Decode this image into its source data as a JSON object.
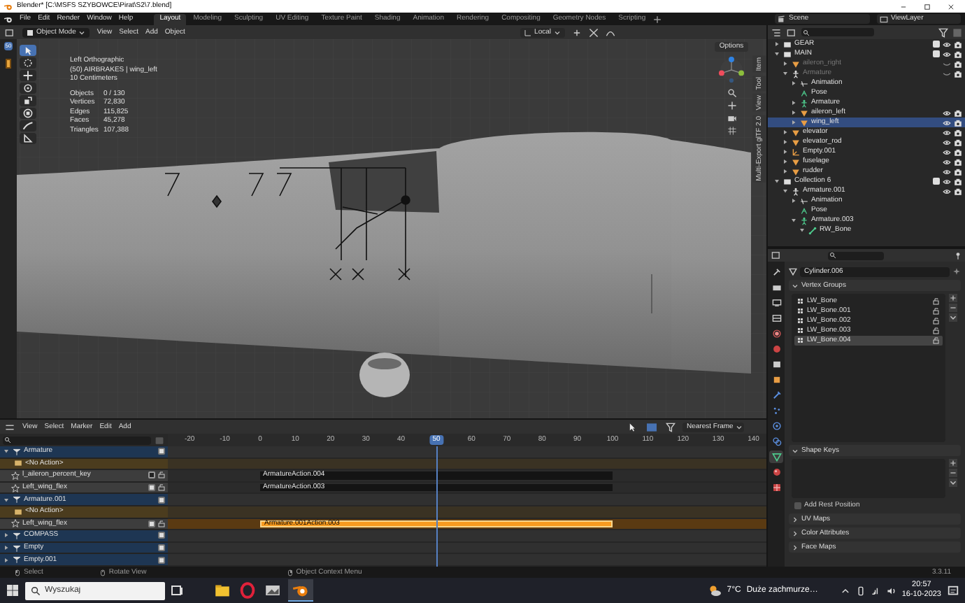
{
  "title_bar": {
    "title": "Blender* [C:\\MSFS SZYBOWCE\\Pirat\\S2\\7.blend]"
  },
  "menu": [
    "File",
    "Edit",
    "Render",
    "Window",
    "Help"
  ],
  "workspaces": [
    {
      "label": "Layout",
      "selected": true
    },
    {
      "label": "Modeling",
      "selected": false
    },
    {
      "label": "Sculpting",
      "selected": false
    },
    {
      "label": "UV Editing",
      "selected": false
    },
    {
      "label": "Texture Paint",
      "selected": false
    },
    {
      "label": "Shading",
      "selected": false
    },
    {
      "label": "Animation",
      "selected": false
    },
    {
      "label": "Rendering",
      "selected": false
    },
    {
      "label": "Compositing",
      "selected": false
    },
    {
      "label": "Geometry Nodes",
      "selected": false
    },
    {
      "label": "Scripting",
      "selected": false
    }
  ],
  "scene": "Scene",
  "view_layer": "ViewLayer",
  "viewport": {
    "mode": "Object Mode",
    "menus": [
      "View",
      "Select",
      "Add",
      "Object"
    ],
    "orientation": "Local",
    "current_frame": "50",
    "info": [
      "Left Orthographic",
      "(50) AIRBRAKES | wing_left",
      "10 Centimeters"
    ],
    "stats": [
      {
        "label": "Objects",
        "value": "0 / 130"
      },
      {
        "label": "Vertices",
        "value": "72,830"
      },
      {
        "label": "Edges",
        "value": "115,825"
      },
      {
        "label": "Faces",
        "value": "45,278"
      },
      {
        "label": "Triangles",
        "value": "107,388"
      }
    ],
    "tools": [
      {
        "kind": "select",
        "selected": true
      },
      {
        "kind": "cursor",
        "selected": false
      },
      {
        "kind": "move",
        "selected": false
      },
      {
        "kind": "rotate",
        "selected": false
      },
      {
        "kind": "scale",
        "selected": false
      },
      {
        "kind": "transform",
        "selected": false
      },
      {
        "kind": "annotate",
        "selected": false
      },
      {
        "kind": "measure",
        "selected": false
      }
    ],
    "options": "Options",
    "side_tabs": [
      "Item",
      "Tool",
      "View",
      "Multi-Export glTF 2.0"
    ]
  },
  "outliner": {
    "items": [
      {
        "name": "GEAR",
        "kind": "collection",
        "expanded": false,
        "checked": true,
        "selected": false
      },
      {
        "name": "MAIN",
        "kind": "collection",
        "expanded": true,
        "checked": true,
        "selected": false,
        "children": [
          {
            "name": "aileron_right",
            "kind": "mesh",
            "expanded": false,
            "hidden": true,
            "selected": false
          },
          {
            "name": "Armature",
            "kind": "armature",
            "expanded": true,
            "hidden": true,
            "selected": false,
            "children": [
              {
                "name": "Animation",
                "kind": "action",
                "expanded": false,
                "selected": false
              },
              {
                "name": "Pose",
                "kind": "pose",
                "selected": false
              },
              {
                "name": "Armature",
                "kind": "armature_data",
                "expanded": false,
                "selected": false
              },
              {
                "name": "aileron_left",
                "kind": "mesh",
                "expanded": false,
                "hidden": false,
                "selected": false
              },
              {
                "name": "wing_left",
                "kind": "mesh",
                "expanded": false,
                "hidden": false,
                "selected": true
              }
            ]
          },
          {
            "name": "elevator",
            "kind": "mesh",
            "expanded": false,
            "hidden": false,
            "selected": false
          },
          {
            "name": "elevator_rod",
            "kind": "mesh",
            "expanded": false,
            "hidden": false,
            "selected": false
          },
          {
            "name": "Empty.001",
            "kind": "empty",
            "expanded": false,
            "hidden": false,
            "selected": false
          },
          {
            "name": "fuselage",
            "kind": "mesh",
            "expanded": false,
            "hidden": false,
            "selected": false
          },
          {
            "name": "rudder",
            "kind": "mesh",
            "expanded": false,
            "hidden": false,
            "selected": false
          }
        ]
      },
      {
        "name": "Collection 6",
        "kind": "collection",
        "expanded": true,
        "checked": true,
        "selected": false,
        "children": [
          {
            "name": "Armature.001",
            "kind": "armature",
            "expanded": true,
            "hidden": false,
            "selected": false,
            "children": [
              {
                "name": "Animation",
                "kind": "action",
                "expanded": false,
                "selected": false
              },
              {
                "name": "Pose",
                "kind": "pose",
                "selected": false
              },
              {
                "name": "Armature.003",
                "kind": "armature_data",
                "expanded": true,
                "selected": false,
                "children": [
                  {
                    "name": "RW_Bone",
                    "kind": "bone",
                    "expanded": true,
                    "selected": false
                  }
                ]
              }
            ]
          }
        ]
      }
    ]
  },
  "properties": {
    "tabs": [
      {
        "kind": "tool",
        "selected": false
      },
      {
        "kind": "render",
        "selected": false
      },
      {
        "kind": "output",
        "selected": false
      },
      {
        "kind": "view_layer",
        "selected": false
      },
      {
        "kind": "scene",
        "selected": false
      },
      {
        "kind": "world",
        "selected": false
      },
      {
        "kind": "collection",
        "selected": false
      },
      {
        "kind": "object",
        "selected": false
      },
      {
        "kind": "modifiers",
        "selected": false
      },
      {
        "kind": "particles",
        "selected": false
      },
      {
        "kind": "physics",
        "selected": false
      },
      {
        "kind": "constraints",
        "selected": false
      },
      {
        "kind": "data",
        "selected": true
      },
      {
        "kind": "material",
        "selected": false
      },
      {
        "kind": "texture",
        "selected": false
      }
    ],
    "object_name": "Cylinder.006",
    "sections": [
      {
        "kind": "list",
        "title": "Vertex Groups",
        "expanded": true,
        "items": [
          {
            "name": "LW_Bone",
            "selected": false
          },
          {
            "name": "LW_Bone.001",
            "selected": false
          },
          {
            "name": "LW_Bone.002",
            "selected": false
          },
          {
            "name": "LW_Bone.003",
            "selected": false
          },
          {
            "name": "LW_Bone.004",
            "selected": true
          }
        ]
      },
      {
        "kind": "list",
        "title": "Shape Keys",
        "expanded": true
      },
      {
        "kind": "checkbox",
        "label": "Add Rest Position",
        "checked": false
      },
      {
        "kind": "panel",
        "title": "UV Maps",
        "expanded": false
      },
      {
        "kind": "panel",
        "title": "Color Attributes",
        "expanded": false
      },
      {
        "kind": "panel",
        "title": "Face Maps",
        "expanded": false
      }
    ]
  },
  "nla": {
    "menus": [
      "View",
      "Select",
      "Marker",
      "Edit",
      "Add"
    ],
    "snapping": "Nearest Frame",
    "ruler": [
      {
        "label": "-20",
        "selected": false
      },
      {
        "label": "-10",
        "selected": false
      },
      {
        "label": "0",
        "selected": false
      },
      {
        "label": "10",
        "selected": false
      },
      {
        "label": "20",
        "selected": false
      },
      {
        "label": "30",
        "selected": false
      },
      {
        "label": "40",
        "selected": false
      },
      {
        "label": "50",
        "selected": true
      },
      {
        "label": "60",
        "selected": false
      },
      {
        "label": "70",
        "selected": false
      },
      {
        "label": "80",
        "selected": false
      },
      {
        "label": "90",
        "selected": false
      },
      {
        "label": "100",
        "selected": false
      },
      {
        "label": "110",
        "selected": false
      },
      {
        "label": "120",
        "selected": false
      },
      {
        "label": "130",
        "selected": false
      },
      {
        "label": "140",
        "selected": false
      }
    ],
    "channels": [
      {
        "kind": "object",
        "name": "Armature",
        "expanded": true,
        "checked": true
      },
      {
        "kind": "action",
        "name": "<No Action>"
      },
      {
        "kind": "track",
        "name": "l_aileron_percent_key",
        "checked": false,
        "strip": {
          "name": "ArmatureAction.004",
          "selected": false
        }
      },
      {
        "kind": "track",
        "name": "Left_wing_flex",
        "checked": true,
        "strip": {
          "name": "ArmatureAction.003",
          "selected": false
        }
      },
      {
        "kind": "object",
        "name": "Armature.001",
        "expanded": true,
        "checked": true
      },
      {
        "kind": "action",
        "name": "<No Action>"
      },
      {
        "kind": "track",
        "name": "Left_wing_flex",
        "checked": true,
        "strip": {
          "name": "Armature.001Action.003",
          "selected": true
        }
      },
      {
        "kind": "object",
        "name": "COMPASS",
        "expanded": false,
        "checked": true
      },
      {
        "kind": "object",
        "name": "Empty",
        "expanded": false,
        "checked": true
      },
      {
        "kind": "object",
        "name": "Empty.001",
        "expanded": false,
        "checked": true
      }
    ]
  },
  "status_bar": {
    "items": [
      "Select",
      "Rotate View",
      "Object Context Menu"
    ],
    "version": "3.3.11"
  },
  "taskbar": {
    "search_placeholder": "Wyszukaj",
    "temperature": "7°C",
    "weather": "Duże zachmurze…",
    "time": "20:57",
    "date": "16-10-2023"
  }
}
